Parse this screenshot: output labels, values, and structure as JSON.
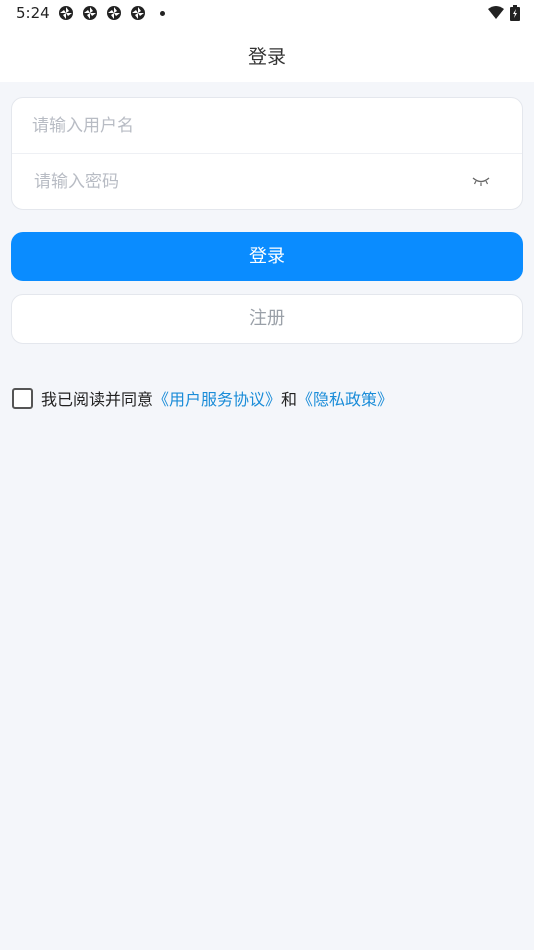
{
  "status_bar": {
    "time": "5:24",
    "notification_icons": [
      "aperture-icon",
      "aperture-icon",
      "aperture-icon",
      "aperture-icon"
    ],
    "wifi_icon": "wifi-icon",
    "battery_icon": "battery-charging-icon"
  },
  "app_bar": {
    "title": "登录"
  },
  "form": {
    "username_placeholder": "请输入用户名",
    "username_value": "",
    "password_placeholder": "请输入密码",
    "password_value": "",
    "password_toggle_icon": "eye-closed-icon"
  },
  "buttons": {
    "login_label": "登录",
    "register_label": "注册"
  },
  "agreement": {
    "checked": false,
    "prefix": "我已阅读并同意",
    "terms_link": "《用户服务协议》",
    "conjunction": "和",
    "privacy_link": "《隐私政策》"
  },
  "colors": {
    "primary": "#0a8cff",
    "link": "#1a8cd8",
    "background": "#f4f6fa"
  }
}
